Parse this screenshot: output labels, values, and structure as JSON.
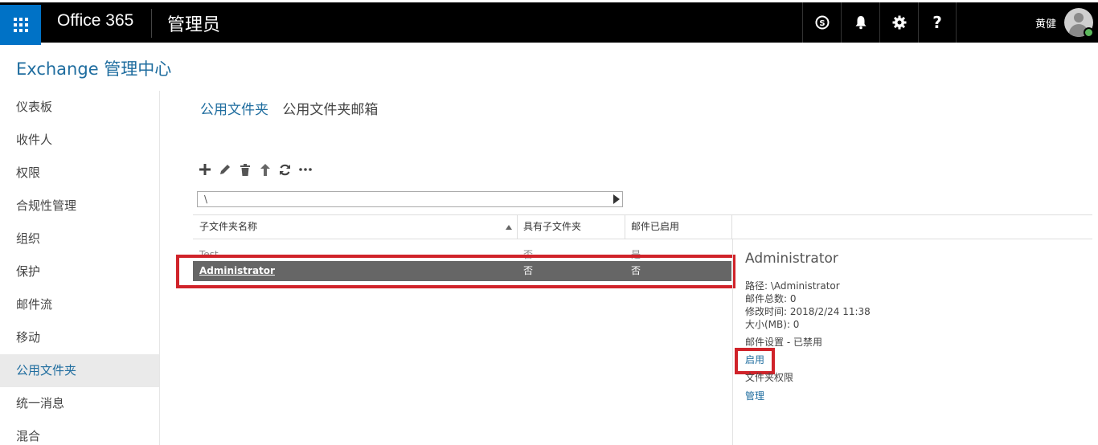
{
  "topbar": {
    "brand": "Office 365",
    "app_title": "管理员",
    "user_name": "黄健",
    "icons": [
      "skype-icon",
      "bell-icon",
      "gear-icon",
      "help-icon"
    ]
  },
  "header": {
    "title": "Exchange 管理中心"
  },
  "leftnav": {
    "items": [
      {
        "label": "仪表板"
      },
      {
        "label": "收件人"
      },
      {
        "label": "权限"
      },
      {
        "label": "合规性管理"
      },
      {
        "label": "组织"
      },
      {
        "label": "保护"
      },
      {
        "label": "邮件流"
      },
      {
        "label": "移动"
      },
      {
        "label": "公用文件夹"
      },
      {
        "label": "统一消息"
      },
      {
        "label": "混合"
      }
    ],
    "active_index": 8
  },
  "tabs": [
    {
      "label": "公用文件夹"
    },
    {
      "label": "公用文件夹邮箱"
    }
  ],
  "path": {
    "value": "\\"
  },
  "table": {
    "columns": [
      "子文件夹名称",
      "具有子文件夹",
      "邮件已启用"
    ],
    "rows": [
      [
        "Test",
        "否",
        "是"
      ],
      [
        "Administrator",
        "否",
        "否"
      ]
    ]
  },
  "details": {
    "title": "Administrator",
    "path": "路径: \\Administrator",
    "total_items": "邮件总数: 0",
    "modified": "修改时间: 2018/2/24 11:38",
    "size": "大小(MB): 0",
    "mail_settings": "邮件设置 - 已禁用",
    "enable_link": "启用",
    "permissions_label": "文件夹权限",
    "manage_link": "管理"
  },
  "colors": {
    "accent": "#0072c6",
    "link": "#1f6d9f",
    "highlight": "#d0232a",
    "selected_row": "#666666"
  }
}
